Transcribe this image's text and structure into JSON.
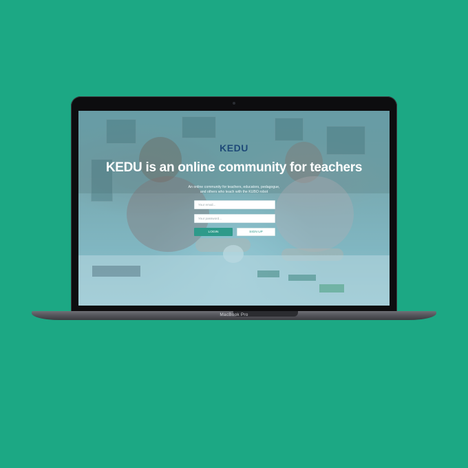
{
  "device": {
    "label": "MacBook Pro"
  },
  "site": {
    "logo": "KEDU",
    "headline": "KEDU is an online community for teachers",
    "subtitle_line1": "An online community for teachers, educators, pedagogue,",
    "subtitle_line2": "and others who teach with the KUBO robot",
    "email_placeholder": "Your email...",
    "password_placeholder": "Your password...",
    "login_label": "LOGIN",
    "signup_label": "SIGN UP"
  },
  "colors": {
    "background": "#1ca884",
    "logo": "#1e4a78",
    "login_button": "#2e9a8a"
  }
}
